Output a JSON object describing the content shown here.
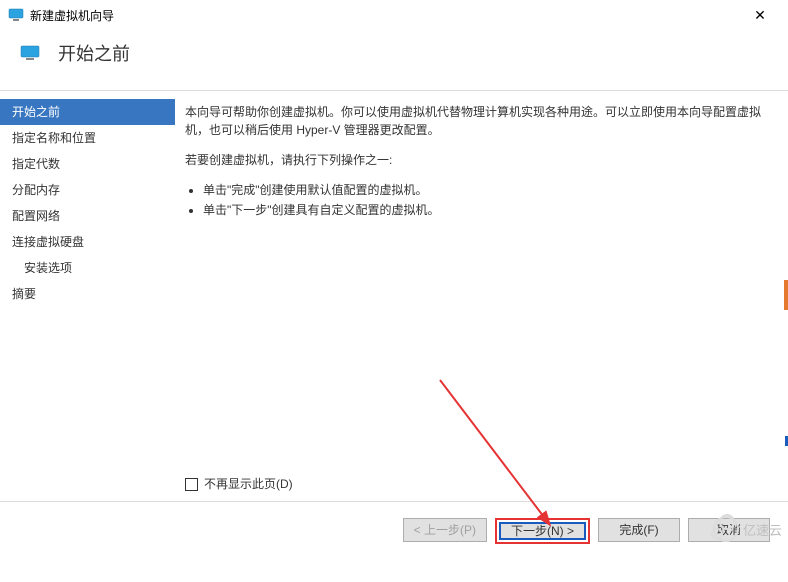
{
  "window": {
    "title": "新建虚拟机向导",
    "close_symbol": "✕"
  },
  "header": {
    "title": "开始之前"
  },
  "sidebar": {
    "items": [
      {
        "label": "开始之前",
        "selected": true,
        "indent": false
      },
      {
        "label": "指定名称和位置",
        "selected": false,
        "indent": false
      },
      {
        "label": "指定代数",
        "selected": false,
        "indent": false
      },
      {
        "label": "分配内存",
        "selected": false,
        "indent": false
      },
      {
        "label": "配置网络",
        "selected": false,
        "indent": false
      },
      {
        "label": "连接虚拟硬盘",
        "selected": false,
        "indent": false
      },
      {
        "label": "安装选项",
        "selected": false,
        "indent": true
      },
      {
        "label": "摘要",
        "selected": false,
        "indent": false
      }
    ]
  },
  "content": {
    "intro": "本向导可帮助你创建虚拟机。你可以使用虚拟机代替物理计算机实现各种用途。可以立即使用本向导配置虚拟机，也可以稍后使用 Hyper-V 管理器更改配置。",
    "prompt": "若要创建虚拟机，请执行下列操作之一:",
    "bullets": [
      "单击\"完成\"创建使用默认值配置的虚拟机。",
      "单击\"下一步\"创建具有自定义配置的虚拟机。"
    ],
    "checkbox_label": "不再显示此页(D)"
  },
  "footer": {
    "prev": "< 上一步(P)",
    "next": "下一步(N) >",
    "finish": "完成(F)",
    "cancel": "取消"
  },
  "watermark": {
    "text": "亿速云"
  },
  "icons": {
    "monitor_fill": "#2aa3e0"
  }
}
